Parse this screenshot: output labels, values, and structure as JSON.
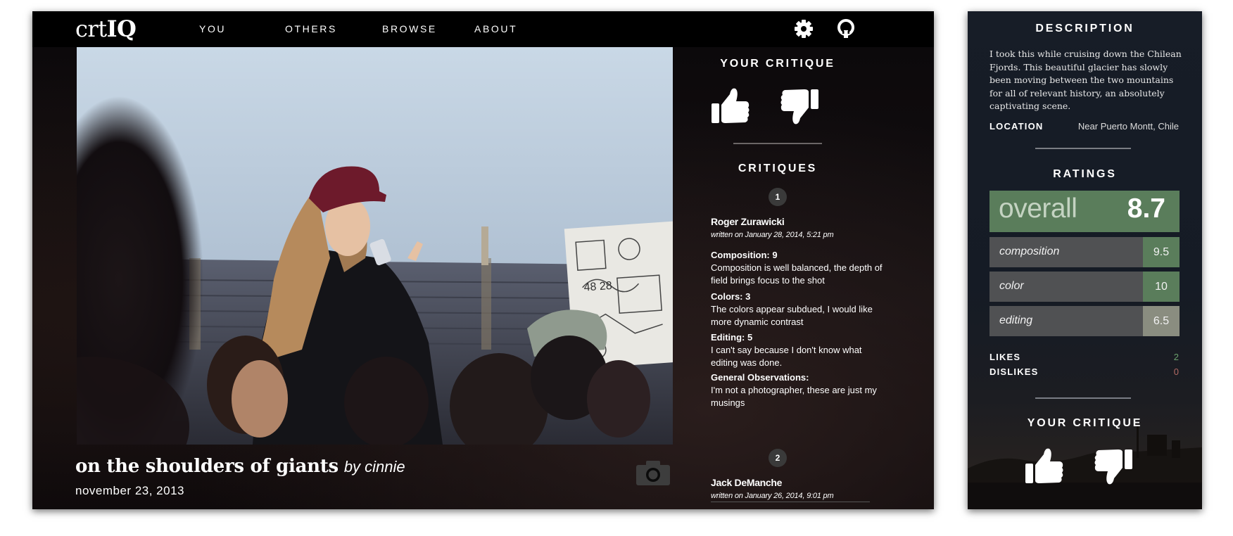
{
  "app": {
    "logo_prefix": "crt",
    "logo_suffix": "IQ"
  },
  "nav": {
    "items": [
      "YOU",
      "OTHERS",
      "BROWSE",
      "ABOUT"
    ],
    "icons": [
      "gear-icon",
      "github-icon"
    ]
  },
  "photo": {
    "title": "on the shoulders of giants",
    "byline": "by cinnie",
    "date": "november 23, 2013",
    "icon": "camera-icon"
  },
  "critique_panel": {
    "your_critique_heading": "YOUR CRITIQUE",
    "critiques_heading": "CRITIQUES",
    "critiques": [
      {
        "number": "1",
        "author": "Roger Zurawicki",
        "written": "written on  January 28, 2014, 5:21 pm",
        "composition_label": "Composition:",
        "composition_score": "9",
        "composition_text": "Composition is well balanced, the depth of field brings focus to the shot",
        "colors_label": "Colors:",
        "colors_score": "3",
        "colors_text": "The colors appear subdued, I would like more dynamic contrast",
        "editing_label": "Editing:",
        "editing_score": "5",
        "editing_text": "I can't say because I don't know what editing was done.",
        "general_label": "General Observations:",
        "general_text": "I'm not a photographer, these are just my musings"
      },
      {
        "number": "2",
        "author": "Jack DeManche",
        "written": "written on  January 26, 2014, 9:01 pm"
      }
    ]
  },
  "side_panel": {
    "description_heading": "DESCRIPTION",
    "description": "I took this while cruising down the Chilean Fjords. This beautiful glacier has slowly been moving between the two mountains for all of relevant history, an absolutely captivating scene.",
    "location_label": "LOCATION",
    "location_value": "Near Puerto Montt, Chile",
    "ratings_heading": "RATINGS",
    "overall_label": "overall",
    "overall_value": "8.7",
    "ratings": [
      {
        "label": "composition",
        "value": "9.5",
        "color": "#5a7d5b"
      },
      {
        "label": "color",
        "value": "10",
        "color": "#5a7d5b"
      },
      {
        "label": "editing",
        "value": "6.5",
        "color": "#8a8d80"
      }
    ],
    "likes_label": "LIKES",
    "likes_value": "2",
    "likes_color": "#6aa06c",
    "dislikes_label": "DISLIKES",
    "dislikes_value": "0",
    "dislikes_color": "#b26a64",
    "your_critique_heading": "YOUR CRITIQUE"
  }
}
